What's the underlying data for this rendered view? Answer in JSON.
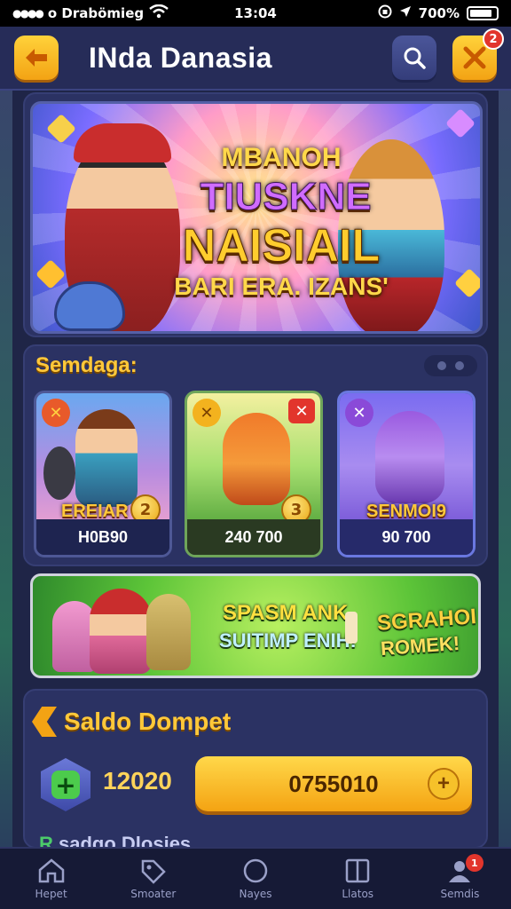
{
  "status_bar": {
    "carrier": "o Drabömieg",
    "time": "13:04",
    "battery": "700%"
  },
  "header": {
    "title": "INda Danasia",
    "notification_count": "2"
  },
  "banner": {
    "line1": "MBANOH",
    "line2": "TIUSKNE",
    "line3": "NAISIAIL",
    "line4": "BARI ERA. IZANS'"
  },
  "section": {
    "title": "Semdaga:"
  },
  "cards": [
    {
      "label": "EREIAR",
      "price": "H0B90",
      "coin": "2"
    },
    {
      "label": "",
      "price": "240 700",
      "coin": "3"
    },
    {
      "label": "SENMOI9",
      "price": "90 700",
      "coin": ""
    }
  ],
  "promo": {
    "line1": "SPASM ANK",
    "line2": "SUITIMP ENIH!",
    "line3": "SGRAHOI",
    "line4": "ROMEK!"
  },
  "wallet": {
    "title": "Saldo Dompet",
    "balance": "12020",
    "button_label": "0755010"
  },
  "next_section_peek": {
    "prefix": "R",
    "text": " sadgo Dlosies"
  },
  "bottom_nav": [
    {
      "label": "Hepet",
      "icon": "home-icon"
    },
    {
      "label": "Smoater",
      "icon": "tag-icon"
    },
    {
      "label": "Nayes",
      "icon": "circle-icon"
    },
    {
      "label": "Llatos",
      "icon": "book-icon"
    },
    {
      "label": "Semdis",
      "icon": "user-icon",
      "badge": "1"
    }
  ],
  "colors": {
    "accent": "#ffc83a",
    "background": "#1f2547",
    "panel": "#2b3263",
    "button_yellow": "#f4a312",
    "badge_red": "#e2352c"
  }
}
